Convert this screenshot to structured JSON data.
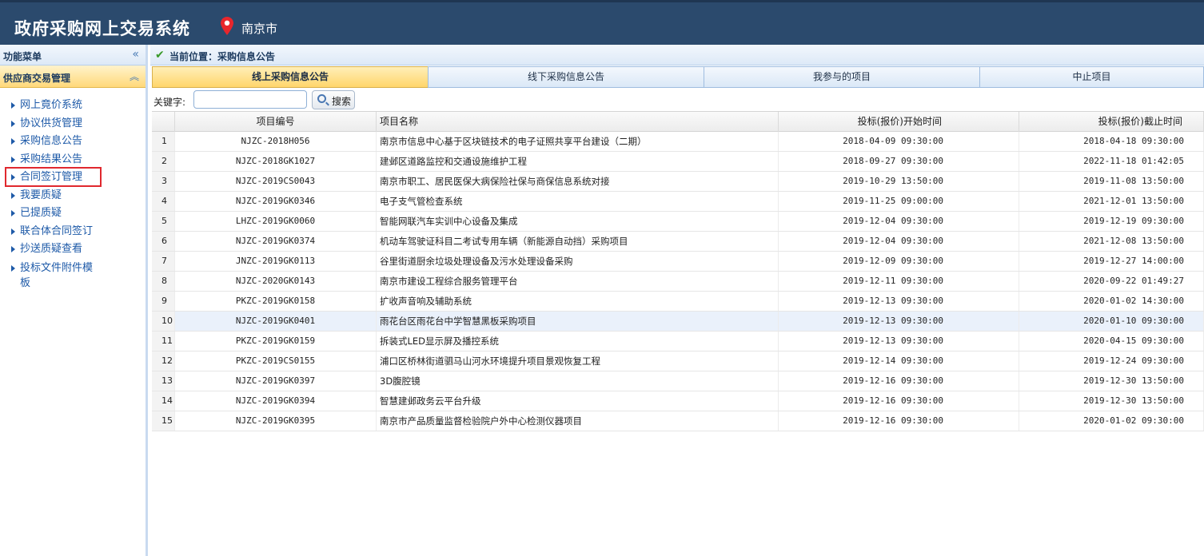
{
  "header": {
    "title": "政府采购网上交易系统",
    "city": "南京市"
  },
  "sidebar": {
    "head_label": "功能菜单",
    "collapse_glyph": "«",
    "group_label": "供应商交易管理",
    "group_glyph": "︽",
    "items": [
      {
        "label": "网上竟价系统"
      },
      {
        "label": "协议供货管理"
      },
      {
        "label": "采购信息公告"
      },
      {
        "label": "采购结果公告"
      },
      {
        "label": "合同签订管理"
      },
      {
        "label": "我要质疑"
      },
      {
        "label": "已提质疑"
      },
      {
        "label": "联合体合同签订"
      },
      {
        "label": "抄送质疑查看"
      },
      {
        "label": "投标文件附件模板"
      }
    ]
  },
  "breadcrumb": {
    "text": "当前位置：采购信息公告"
  },
  "tabs": [
    {
      "label": "线上采购信息公告"
    },
    {
      "label": "线下采购信息公告"
    },
    {
      "label": "我参与的项目"
    },
    {
      "label": "中止项目"
    }
  ],
  "search": {
    "label": "关键字:",
    "value": "",
    "placeholder": "",
    "button": "搜索"
  },
  "table": {
    "headers": {
      "id": "项目编号",
      "name": "项目名称",
      "start": "投标(报价)开始时间",
      "end": "投标(报价)截止时间"
    },
    "rows": [
      {
        "n": "1",
        "id": "NJZC-2018H056",
        "name": "南京市信息中心基于区块链技术的电子证照共享平台建设（二期）",
        "start": "2018-04-09 09:30:00",
        "end": "2018-04-18 09:30:00"
      },
      {
        "n": "2",
        "id": "NJZC-2018GK1027",
        "name": "建邺区道路监控和交通设施维护工程",
        "start": "2018-09-27 09:30:00",
        "end": "2022-11-18 01:42:05"
      },
      {
        "n": "3",
        "id": "NJZC-2019CS0043",
        "name": "南京市职工、居民医保大病保险社保与商保信息系统对接",
        "start": "2019-10-29 13:50:00",
        "end": "2019-11-08 13:50:00"
      },
      {
        "n": "4",
        "id": "NJZC-2019GK0346",
        "name": "电子支气管检查系统",
        "start": "2019-11-25 09:00:00",
        "end": "2021-12-01 13:50:00"
      },
      {
        "n": "5",
        "id": "LHZC-2019GK0060",
        "name": "智能网联汽车实训中心设备及集成",
        "start": "2019-12-04 09:30:00",
        "end": "2019-12-19 09:30:00"
      },
      {
        "n": "6",
        "id": "NJZC-2019GK0374",
        "name": "机动车驾驶证科目二考试专用车辆（新能源自动挡）采购项目",
        "start": "2019-12-04 09:30:00",
        "end": "2021-12-08 13:50:00"
      },
      {
        "n": "7",
        "id": "JNZC-2019GK0113",
        "name": "谷里街道厨余垃圾处理设备及污水处理设备采购",
        "start": "2019-12-09 09:30:00",
        "end": "2019-12-27 14:00:00"
      },
      {
        "n": "8",
        "id": "NJZC-2020GK0143",
        "name": "南京市建设工程综合服务管理平台",
        "start": "2019-12-11 09:30:00",
        "end": "2020-09-22 01:49:27"
      },
      {
        "n": "9",
        "id": "PKZC-2019GK0158",
        "name": "扩收声音响及辅助系统",
        "start": "2019-12-13 09:30:00",
        "end": "2020-01-02 14:30:00"
      },
      {
        "n": "10",
        "id": "NJZC-2019GK0401",
        "name": "雨花台区雨花台中学智慧黑板采购项目",
        "start": "2019-12-13 09:30:00",
        "end": "2020-01-10 09:30:00"
      },
      {
        "n": "11",
        "id": "PKZC-2019GK0159",
        "name": "拆装式LED显示屏及播控系统",
        "start": "2019-12-13 09:30:00",
        "end": "2020-04-15 09:30:00"
      },
      {
        "n": "12",
        "id": "PKZC-2019CS0155",
        "name": "浦口区桥林街道驷马山河水环境提升项目景观恢复工程",
        "start": "2019-12-14 09:30:00",
        "end": "2019-12-24 09:30:00"
      },
      {
        "n": "13",
        "id": "NJZC-2019GK0397",
        "name": "3D腹腔镜",
        "start": "2019-12-16 09:30:00",
        "end": "2019-12-30 13:50:00"
      },
      {
        "n": "14",
        "id": "NJZC-2019GK0394",
        "name": "智慧建邺政务云平台升级",
        "start": "2019-12-16 09:30:00",
        "end": "2019-12-30 13:50:00"
      },
      {
        "n": "15",
        "id": "NJZC-2019GK0395",
        "name": "南京市产品质量监督检验院户外中心检测仪器项目",
        "start": "2019-12-16 09:30:00",
        "end": "2020-01-02 09:30:00"
      }
    ]
  }
}
